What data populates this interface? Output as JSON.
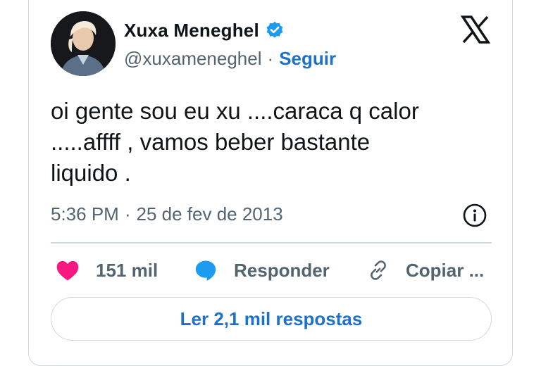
{
  "author": {
    "display_name": "Xuxa Meneghel",
    "handle": "@xuxameneghel",
    "separator": "·",
    "follow_label": "Seguir"
  },
  "tweet": {
    "text": "oi gente sou eu xu ....caraca q calor\n.....affff , vamos beber bastante\nliquido .",
    "time": "5:36 PM",
    "date_separator": "·",
    "date": "25 de fev de 2013"
  },
  "actions": {
    "likes": "151 mil",
    "reply_label": "Responder",
    "copy_label": "Copiar ..."
  },
  "read_replies_label": "Ler 2,1 mil respostas",
  "icons": {
    "logo": "x-logo-icon",
    "verified": "verified-badge-icon",
    "info": "info-icon",
    "like": "heart-icon",
    "reply": "speech-bubble-icon",
    "copy": "link-icon"
  },
  "colors": {
    "accent": "#1d72c8",
    "verified": "#1d9bf0",
    "like": "#f91880",
    "secondary_text": "#536471",
    "primary_text": "#0f1419",
    "border": "#cfd9de"
  }
}
